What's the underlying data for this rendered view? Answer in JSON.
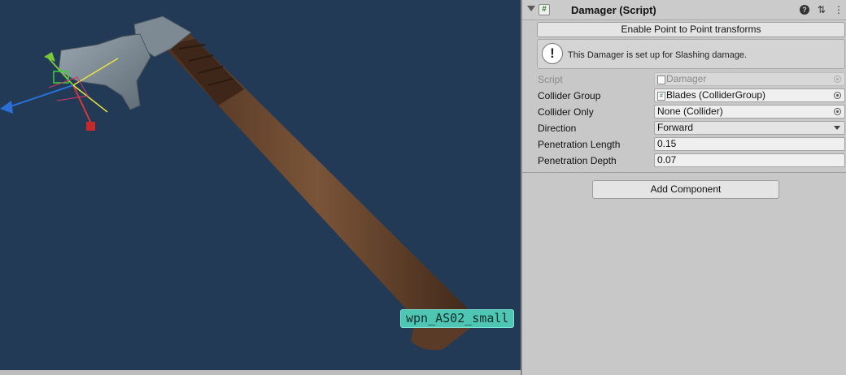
{
  "scene": {
    "object_label": "wpn_AS02_small"
  },
  "inspector": {
    "component": {
      "checkbox_glyph": "#",
      "title": "Damager (Script)",
      "help_glyph": "?",
      "preset_glyph": "⇅",
      "menu_glyph": "⋮"
    },
    "enable_button_label": "Enable Point to Point transforms",
    "helpbox": {
      "icon_glyph": "!",
      "text": "This Damager is set up for Slashing damage."
    },
    "properties": {
      "script": {
        "label": "Script",
        "value": "Damager"
      },
      "collider_group": {
        "label": "Collider Group",
        "value": "Blades (ColliderGroup)"
      },
      "collider_only": {
        "label": "Collider Only",
        "value": "None (Collider)"
      },
      "direction": {
        "label": "Direction",
        "value": "Forward"
      },
      "penetration_length": {
        "label": "Penetration Length",
        "value": "0.15"
      },
      "penetration_depth": {
        "label": "Penetration Depth",
        "value": "0.07"
      }
    },
    "add_component_label": "Add Component"
  },
  "colors": {
    "scene_background": "#223a55",
    "label_teal": "#4fc6b3",
    "inspector_background": "#c8c8c8"
  }
}
